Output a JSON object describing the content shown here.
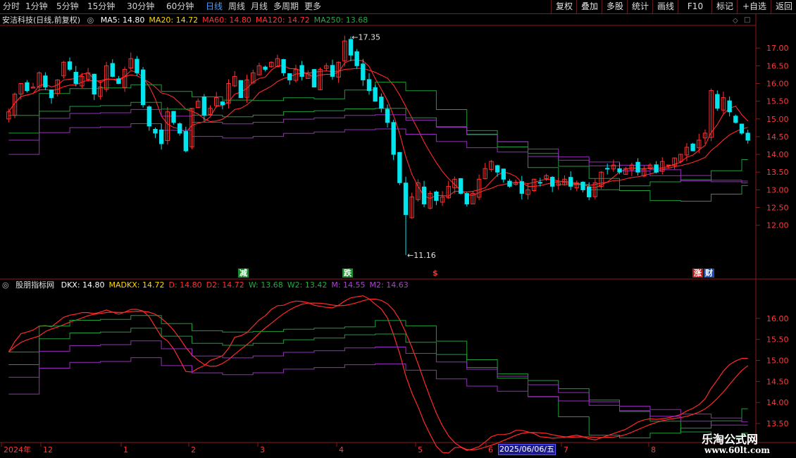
{
  "toolbar": {
    "periods": [
      "分时",
      "1分钟",
      "5分钟",
      "15分钟",
      "30分钟",
      "60分钟",
      "日线",
      "周线",
      "月线",
      "多周期",
      "更多"
    ],
    "active_period": "日线",
    "right_buttons": [
      "复权",
      "叠加",
      "多股",
      "统计",
      "画线",
      "F10",
      "标记",
      "+自选",
      "返回"
    ]
  },
  "price_panel": {
    "title": "安洁科技(日线,前复权)",
    "ma_labels": [
      {
        "text": "MA5: 14.80",
        "color": "#ffffff"
      },
      {
        "text": "MA20: 14.72",
        "color": "#ffd700"
      },
      {
        "text": "MA60: 14.80",
        "color": "#ff3030"
      },
      {
        "text": "MA120: 14.72",
        "color": "#ff3030"
      },
      {
        "text": "MA250: 13.68",
        "color": "#22aa44"
      }
    ],
    "y_ticks": [
      "17.00",
      "16.50",
      "16.00",
      "15.50",
      "15.00",
      "14.50",
      "14.00",
      "13.50",
      "13.00",
      "12.50",
      "12.00"
    ],
    "ylim": [
      11.0,
      17.6
    ],
    "high_label": "17.35",
    "low_label": "11.16",
    "signal_marks": [
      {
        "text": "减",
        "bg": "#1a8a2a",
        "color": "#ffffff"
      },
      {
        "text": "跌",
        "bg": "#1a8a2a",
        "color": "#ffffff"
      },
      {
        "text": "$",
        "bg": "",
        "color": "#ff3030"
      },
      {
        "text": "涨",
        "bg": "#c01818",
        "color": "#ffffff"
      },
      {
        "text": "财",
        "bg": "#1a4aaa",
        "color": "#ffffff"
      }
    ]
  },
  "indicator_panel": {
    "title": "股朋指标网",
    "labels": [
      {
        "text": "DKX: 14.80",
        "color": "#ffffff"
      },
      {
        "text": "MADKX: 14.72",
        "color": "#ffd700"
      },
      {
        "text": "D: 14.80",
        "color": "#ff3030"
      },
      {
        "text": "D2: 14.72",
        "color": "#ff3030"
      },
      {
        "text": "W: 13.68",
        "color": "#22aa44"
      },
      {
        "text": "W2: 13.42",
        "color": "#22aa44"
      },
      {
        "text": "M: 14.55",
        "color": "#aa44cc"
      },
      {
        "text": "M2: 14.63",
        "color": "#aa44cc"
      }
    ],
    "y_ticks": [
      "16.00",
      "15.50",
      "15.00",
      "14.50",
      "14.00",
      "13.50"
    ],
    "ylim": [
      13.15,
      16.6
    ]
  },
  "x_axis": {
    "labels": [
      "2024年",
      "12",
      "1",
      "2",
      "3",
      "4",
      "5",
      "6",
      "7",
      "8"
    ],
    "cursor_date": "2025/06/06/五"
  },
  "watermark": {
    "line1": "乐淘公式网",
    "line2": "www.60lt.com"
  },
  "colors": {
    "up": "#ff3030",
    "down": "#00e5ee",
    "ma60": "#ff2a2a",
    "ma120": "#ff2a2a",
    "ma250": "#1e9e3a",
    "purple": "#9a2cc0",
    "grid_red": "#8a1a1a",
    "axis_text": "#ff3a3a"
  },
  "chart_data": {
    "type": "candlestick",
    "series_desc": "daily OHLC, approx reconstruction",
    "candles_close": [
      15.2,
      15.7,
      16.0,
      15.8,
      15.9,
      16.3,
      15.9,
      15.6,
      16.1,
      16.6,
      16.4,
      16.0,
      16.2,
      16.3,
      15.7,
      15.9,
      16.5,
      16.2,
      16.0,
      16.4,
      16.7,
      16.3,
      15.4,
      14.8,
      14.6,
      14.3,
      15.2,
      14.9,
      14.6,
      14.1,
      15.3,
      15.5,
      15.1,
      15.3,
      15.6,
      15.4,
      16.0,
      16.2,
      15.6,
      16.1,
      16.3,
      16.5,
      16.4,
      16.6,
      16.7,
      16.3,
      16.1,
      16.4,
      16.2,
      16.3,
      15.9,
      16.4,
      16.5,
      16.2,
      16.6,
      17.2,
      16.8,
      16.5,
      16.1,
      15.8,
      15.5,
      15.3,
      14.9,
      14.0,
      13.2,
      12.3,
      12.8,
      13.2,
      12.6,
      12.9,
      12.7,
      12.8,
      13.1,
      13.3,
      12.9,
      12.6,
      12.9,
      13.3,
      13.6,
      13.8,
      13.5,
      13.3,
      13.1,
      13.2,
      12.9,
      13.0,
      13.3,
      13.2,
      13.4,
      13.1,
      13.2,
      13.3,
      13.1,
      13.2,
      13.0,
      12.8,
      13.2,
      13.5,
      13.6,
      13.7,
      13.5,
      13.6,
      13.7,
      13.5,
      13.6,
      13.7,
      13.5,
      13.8,
      13.7,
      13.9,
      14.0,
      14.2,
      14.1,
      14.4,
      14.6,
      15.8,
      15.3,
      15.6,
      15.2,
      14.9,
      14.6,
      14.4
    ]
  }
}
